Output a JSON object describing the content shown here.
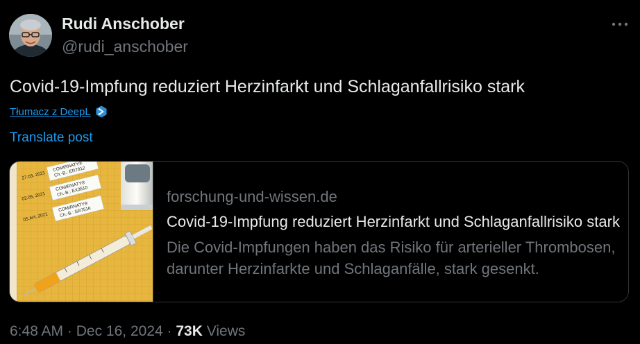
{
  "author": {
    "display_name": "Rudi Anschober",
    "handle": "@rudi_anschober"
  },
  "post": {
    "text": "Covid-19-Impfung reduziert Herzinfarkt und Schlaganfallrisiko stark",
    "deepl_link": "Tłumacz z DeepL",
    "translate_link": "Translate post"
  },
  "link_card": {
    "domain": "forschung-und-wissen.de",
    "title": "Covid-19-Impfung reduziert Herzinfarkt und Schlaganfallrisiko stark",
    "description": "Die Covid-Impfungen haben das Risiko für arterieller Thrombosen, darunter Herzinfarkte und Schlaganfälle, stark gesenkt.",
    "image": {
      "label_brand": "COMIRNATY®",
      "labels": [
        {
          "date": "27.03. 2021",
          "batch": "Ch.-B.: ER7812"
        },
        {
          "date": "02.05. 2021",
          "batch": "Ch.-B.: EX3510"
        },
        {
          "date": "05.AH. 2021",
          "batch": "Ch.-B.: SR7516"
        }
      ]
    }
  },
  "meta": {
    "time": "6:48 AM",
    "separator": "·",
    "date": "Dec 16, 2024",
    "views_count": "73K",
    "views_label": "Views"
  },
  "icons": {
    "more": "more-horizontal-icon",
    "deepl": "deepl-logo-icon"
  },
  "colors": {
    "background": "#000000",
    "text_primary": "#e7e9ea",
    "text_secondary": "#71767b",
    "accent": "#1d9bf0",
    "border": "#2f3336",
    "deepl": "#0f2b46"
  }
}
